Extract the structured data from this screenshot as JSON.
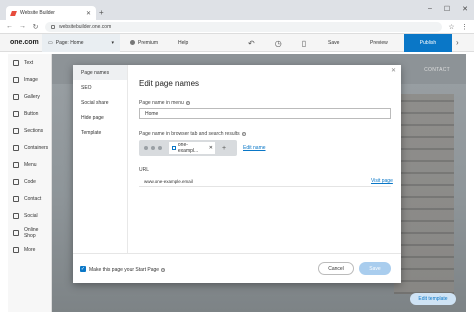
{
  "browser": {
    "tab_title": "Website Builder",
    "url": "websitebuilder.one.com"
  },
  "toolbar": {
    "logo": "one.com",
    "page_selector": "Page: Home",
    "premium": "Premium",
    "help": "Help",
    "save": "Save",
    "preview": "Preview",
    "publish": "Publish"
  },
  "sidebar": {
    "items": [
      {
        "label": "Text",
        "icon": "text-icon"
      },
      {
        "label": "Image",
        "icon": "image-icon"
      },
      {
        "label": "Gallery",
        "icon": "gallery-icon"
      },
      {
        "label": "Button",
        "icon": "button-icon"
      },
      {
        "label": "Sections",
        "icon": "sections-icon"
      },
      {
        "label": "Containers",
        "icon": "containers-icon"
      },
      {
        "label": "Menu",
        "icon": "menu-icon"
      },
      {
        "label": "Code",
        "icon": "code-icon"
      },
      {
        "label": "Contact",
        "icon": "contact-icon"
      },
      {
        "label": "Social",
        "icon": "social-icon"
      },
      {
        "label": "Online Shop",
        "icon": "shop-icon"
      },
      {
        "label": "More",
        "icon": "more-icon"
      }
    ]
  },
  "canvas": {
    "contact_nav": "CONTACT",
    "edit_template": "Edit template"
  },
  "modal": {
    "nav": [
      "Page names",
      "SEO",
      "Social share",
      "Hide page",
      "Template"
    ],
    "active_nav": "Page names",
    "title": "Edit page names",
    "menu_name_label": "Page name in menu",
    "menu_name_value": "Home",
    "browser_name_label": "Page name in browser tab and search results",
    "preview_tab_text": "one-exampl...",
    "edit_name_link": "Edit name",
    "url_label": "URL",
    "url_value": "www.one-example.email",
    "visit_link": "Visit page",
    "start_page_label": "Make this page your Start Page",
    "cancel": "Cancel",
    "save": "Save"
  },
  "colors": {
    "accent": "#0a77c7",
    "save_disabled": "#a9cdee"
  }
}
